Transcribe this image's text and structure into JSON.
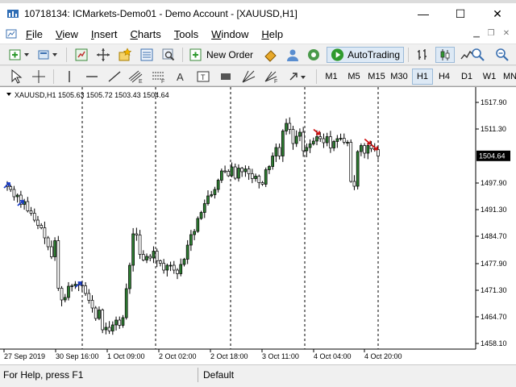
{
  "window": {
    "title": "10718134: ICMarkets-Demo01 - Demo Account - [XAUUSD,H1]",
    "minimize": "—",
    "maximize": "☐",
    "close": "✕"
  },
  "menu": [
    {
      "label": "File",
      "key": "F"
    },
    {
      "label": "View",
      "key": "V"
    },
    {
      "label": "Insert",
      "key": "I"
    },
    {
      "label": "Charts",
      "key": "C"
    },
    {
      "label": "Tools",
      "key": "T"
    },
    {
      "label": "Window",
      "key": "W"
    },
    {
      "label": "Help",
      "key": "H"
    }
  ],
  "toolbar": {
    "new_order": "New Order",
    "autotrading": "AutoTrading"
  },
  "timeframes": [
    "M1",
    "M5",
    "M15",
    "M30",
    "H1",
    "H4",
    "D1",
    "W1",
    "MN"
  ],
  "active_timeframe": "H1",
  "status": {
    "help": "For Help, press F1",
    "profile": "Default"
  },
  "chart_data": {
    "type": "candlestick",
    "header": "XAUUSD,H1  1505.63 1505.72 1503.43 1504.64",
    "symbol": "XAUUSD,H1",
    "current_price": "1504.64",
    "price_ticks": [
      "1517.90",
      "1511.30",
      "1504.64",
      "1497.90",
      "1491.30",
      "1484.70",
      "1477.90",
      "1471.30",
      "1464.70",
      "1458.10"
    ],
    "tick_values": [
      1517.9,
      1511.3,
      1504.64,
      1497.9,
      1491.3,
      1484.7,
      1477.9,
      1471.3,
      1464.7,
      1458.1
    ],
    "ylim": [
      1456.7,
      1521.7
    ],
    "time_labels": [
      "27 Sep 2019",
      "30 Sep 16:00",
      "1 Oct 09:00",
      "2 Oct 02:00",
      "2 Oct 18:00",
      "3 Oct 11:00",
      "4 Oct 04:00",
      "4 Oct 20:00"
    ],
    "closes": [
      1497.0,
      1496.3,
      1494.5,
      1494.9,
      1492.6,
      1493.3,
      1491.0,
      1490.4,
      1488.7,
      1487.4,
      1486.8,
      1484.3,
      1482.1,
      1479.6,
      1483.6,
      1471.8,
      1468.9,
      1469.5,
      1472.3,
      1472.4,
      1472.8,
      1472.6,
      1472.4,
      1470.5,
      1468.8,
      1466.9,
      1464.3,
      1466.4,
      1461.5,
      1462.1,
      1461.2,
      1462.7,
      1463.9,
      1462.6,
      1464.5,
      1471.7,
      1477.5,
      1485.3,
      1485.0,
      1480.2,
      1478.8,
      1479.7,
      1479.3,
      1481.0,
      1478.6,
      1478.0,
      1476.3,
      1477.5,
      1477.5,
      1476.3,
      1475.4,
      1477.7,
      1479.0,
      1482.5,
      1485.1,
      1485.9,
      1489.1,
      1490.6,
      1492.8,
      1494.7,
      1495.0,
      1496.3,
      1498.6,
      1500.9,
      1500.8,
      1499.7,
      1501.9,
      1499.1,
      1501.6,
      1500.7,
      1501.4,
      1500.2,
      1499.0,
      1499.6,
      1498.0,
      1497.6,
      1501.2,
      1502.0,
      1504.6,
      1506.7,
      1504.6,
      1510.8,
      1512.7,
      1511.2,
      1507.7,
      1509.5,
      1510.5,
      1505.9,
      1506.7,
      1507.6,
      1508.3,
      1509.4,
      1508.9,
      1507.9,
      1509.4,
      1506.6,
      1508.2,
      1508.9,
      1509.0,
      1508.0,
      1508.0,
      1498.3,
      1497.1,
      1505.7,
      1507.2,
      1505.3,
      1507.2,
      1506.4,
      1506.2,
      1504.6
    ]
  }
}
